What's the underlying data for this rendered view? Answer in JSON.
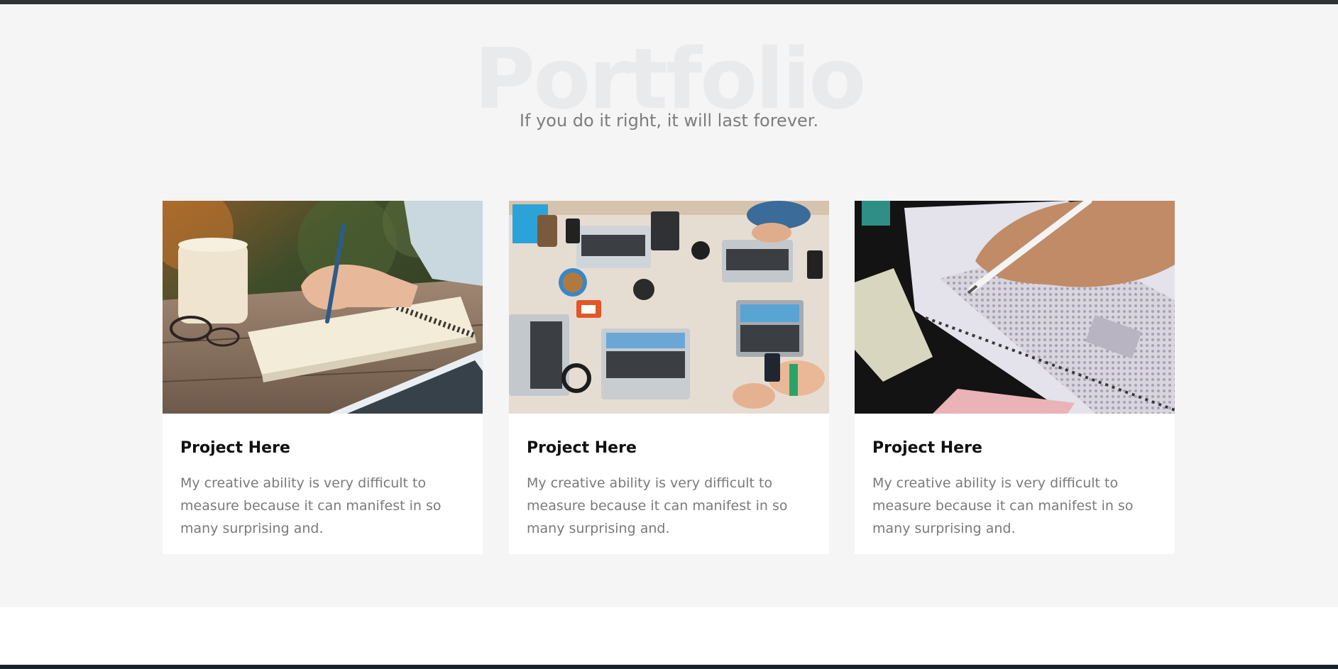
{
  "section": {
    "background_title": "Portfolio",
    "subtitle": "If you do it right, it will last forever."
  },
  "projects": [
    {
      "title": "Project Here",
      "description": "My creative ability is very difficult to measure because it can manifest in so many surprising and.",
      "image": "writing-notebook-photo"
    },
    {
      "title": "Project Here",
      "description": "My creative ability is very difficult to measure because it can manifest in so many surprising and.",
      "image": "team-laptops-desk-photo"
    },
    {
      "title": "Project Here",
      "description": "My creative ability is very difficult to measure because it can manifest in so many surprising and.",
      "image": "answer-sheet-pencil-photo"
    }
  ],
  "colors": {
    "section_background": "#f5f5f5",
    "card_background": "#ffffff",
    "title_color": "#111111",
    "text_color": "#7a7a7a",
    "watermark_color": "#e9eaec",
    "top_bar": "#2f3137",
    "bottom_bar": "#17232b"
  }
}
